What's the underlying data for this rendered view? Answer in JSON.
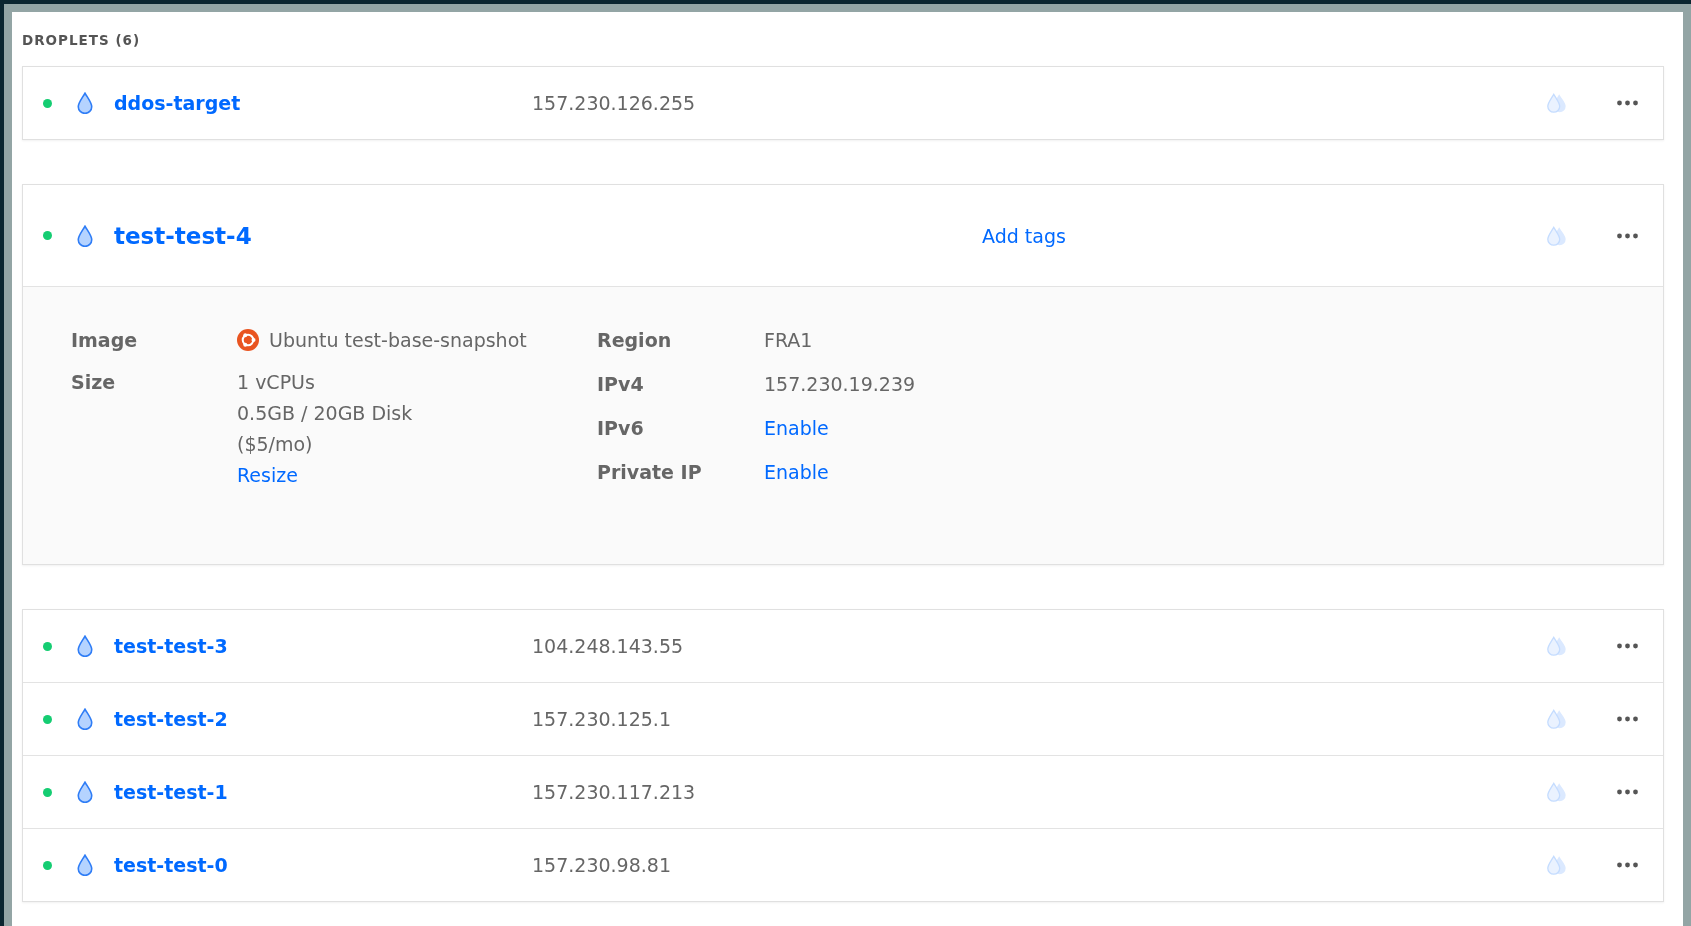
{
  "section_title": "DROPLETS (6)",
  "droplets": [
    {
      "kind": "row",
      "name": "ddos-target",
      "ip": "157.230.126.255"
    },
    {
      "kind": "expanded",
      "name": "test-test-4",
      "add_tags": "Add tags",
      "details_left": [
        {
          "label": "Image",
          "lines": [
            "Ubuntu test-base-snapshot"
          ],
          "os_icon": true
        },
        {
          "label": "Size",
          "lines": [
            "1 vCPUs",
            "0.5GB / 20GB Disk",
            "($5/mo)"
          ],
          "link": "Resize"
        }
      ],
      "details_right": [
        {
          "label": "Region",
          "value": "FRA1"
        },
        {
          "label": "IPv4",
          "value": "157.230.19.239"
        },
        {
          "label": "IPv6",
          "link": "Enable"
        },
        {
          "label": "Private IP",
          "link": "Enable"
        }
      ]
    },
    {
      "kind": "row",
      "name": "test-test-3",
      "ip": "104.248.143.55"
    },
    {
      "kind": "row",
      "name": "test-test-2",
      "ip": "157.230.125.1"
    },
    {
      "kind": "row",
      "name": "test-test-1",
      "ip": "157.230.117.213"
    },
    {
      "kind": "row",
      "name": "test-test-0",
      "ip": "157.230.98.81"
    }
  ]
}
